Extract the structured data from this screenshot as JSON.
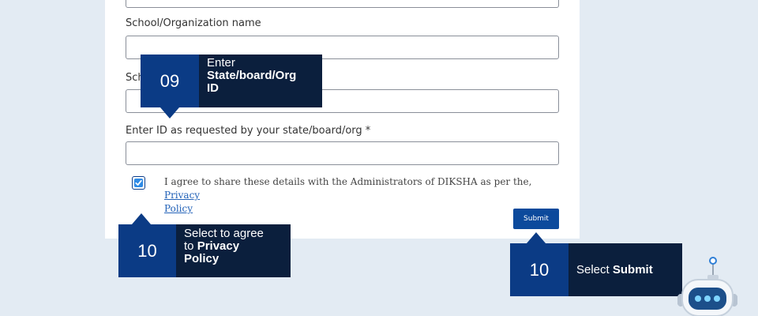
{
  "form": {
    "org_name_label": "School/Organization name",
    "school_label_partial": "Sch",
    "id_label": "Enter ID as requested by your state/board/org *",
    "agree_text": "I agree to share these details with the Administrators of DIKSHA as per the, ",
    "privacy_link_word1": "Privacy",
    "privacy_link_word2": "Policy",
    "agree_checked": true,
    "submit_label": "Submit"
  },
  "callouts": {
    "step09": {
      "number": "09",
      "line1": "Enter",
      "bold": "State/board/Org",
      "bold2": "ID"
    },
    "step10a": {
      "number": "10",
      "line1": "Select to agree",
      "line2_prefix": "to ",
      "bold": "Privacy",
      "bold2": "Policy"
    },
    "step10b": {
      "number": "10",
      "prefix": "Select ",
      "bold": "Submit"
    }
  },
  "colors": {
    "background": "#e3ebf3",
    "callout_number_bg": "#0b3b85",
    "callout_text_bg": "#0b1f3d",
    "submit_bg": "#0c4a9c",
    "checkbox_fill": "#2f8be6"
  },
  "icons": {
    "checkbox": "checkmark-icon",
    "mascot": "robot-mascot-icon"
  }
}
